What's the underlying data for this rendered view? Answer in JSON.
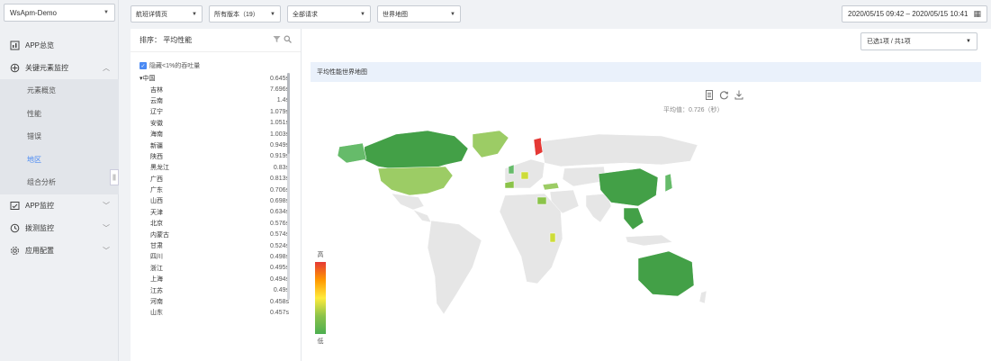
{
  "app_select": {
    "value": "WsApm-Demo"
  },
  "sidebar": {
    "items": [
      {
        "label": "APP总览"
      },
      {
        "label": "关键元素监控"
      },
      {
        "label": "APP监控"
      },
      {
        "label": "拨测监控"
      },
      {
        "label": "应用配置"
      }
    ],
    "sub_items": [
      {
        "label": "元素概览"
      },
      {
        "label": "性能"
      },
      {
        "label": "错误"
      },
      {
        "label": "地区"
      },
      {
        "label": "组合分析"
      }
    ],
    "active_sub": "地区"
  },
  "toolbar": {
    "page_filter": "航班详情页",
    "version_filter": "所有版本（19）",
    "request_filter": "全部请求",
    "map_filter": "世界地图",
    "date_range": "2020/05/15 09:42 – 2020/05/15 10:41"
  },
  "list": {
    "sort_label": "排序：  平均性能",
    "hide_label": "隐藏<1%的吞吐量",
    "country": {
      "label": "中国",
      "value": "0.645s"
    },
    "provinces": [
      {
        "label": "吉林",
        "value": "7.696s"
      },
      {
        "label": "云南",
        "value": "1.4s"
      },
      {
        "label": "辽宁",
        "value": "1.079s"
      },
      {
        "label": "安徽",
        "value": "1.051s"
      },
      {
        "label": "海南",
        "value": "1.003s"
      },
      {
        "label": "新疆",
        "value": "0.949s"
      },
      {
        "label": "陕西",
        "value": "0.919s"
      },
      {
        "label": "黑龙江",
        "value": "0.83s"
      },
      {
        "label": "广西",
        "value": "0.813s"
      },
      {
        "label": "广东",
        "value": "0.706s"
      },
      {
        "label": "山西",
        "value": "0.698s"
      },
      {
        "label": "天津",
        "value": "0.634s"
      },
      {
        "label": "北京",
        "value": "0.576s"
      },
      {
        "label": "内蒙古",
        "value": "0.574s"
      },
      {
        "label": "甘肃",
        "value": "0.524s"
      },
      {
        "label": "四川",
        "value": "0.498s"
      },
      {
        "label": "浙江",
        "value": "0.495s"
      },
      {
        "label": "上海",
        "value": "0.494s"
      },
      {
        "label": "江苏",
        "value": "0.49s"
      },
      {
        "label": "河南",
        "value": "0.458s"
      },
      {
        "label": "山东",
        "value": "0.457s"
      }
    ]
  },
  "map": {
    "selector": "已选1项 / 共1项",
    "title": "平均性能世界地图",
    "average": "平均值：0.726（秒）",
    "legend_high": "高",
    "legend_low": "低"
  },
  "colors": {
    "accent": "#4a8af4",
    "high": "#e53935",
    "low": "#4caf50",
    "no_data": "#e6e6e6"
  }
}
